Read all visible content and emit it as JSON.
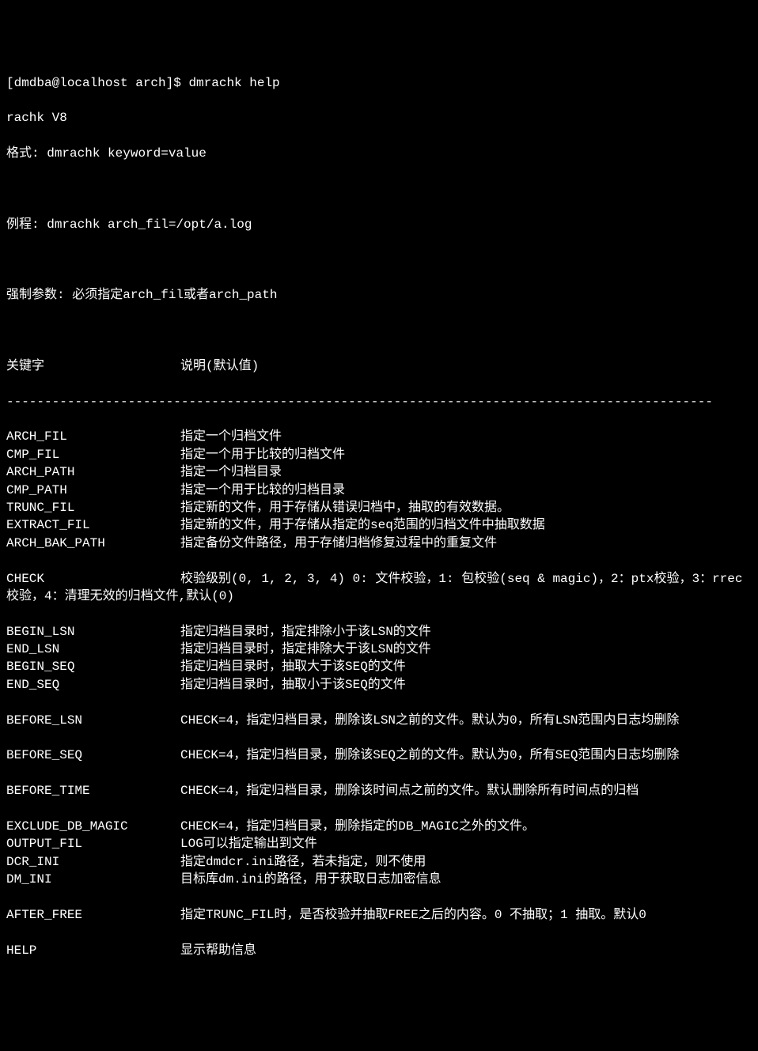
{
  "prompt": "[dmdba@localhost arch]$ ",
  "command": "dmrachk help",
  "version": "rachk V8",
  "usage_label": "格式: ",
  "usage_value": "dmrachk keyword=value",
  "example_label": "例程: ",
  "example_value": "dmrachk arch_fil=/opt/a.log",
  "required_label": "强制参数: ",
  "required_value": "必须指定arch_fil或者arch_path",
  "header_key": "关键字",
  "header_desc": "说明(默认值)",
  "divider": "---------------------------------------------------------------------------------------------",
  "rows": [
    {
      "key": "ARCH_FIL",
      "desc": "指定一个归档文件"
    },
    {
      "key": "CMP_FIL",
      "desc": "指定一个用于比较的归档文件"
    },
    {
      "key": "ARCH_PATH",
      "desc": "指定一个归档目录"
    },
    {
      "key": "CMP_PATH",
      "desc": "指定一个用于比较的归档目录"
    },
    {
      "key": "TRUNC_FIL",
      "desc": "指定新的文件，用于存储从错误归档中，抽取的有效数据。"
    },
    {
      "key": "EXTRACT_FIL",
      "desc": "指定新的文件，用于存储从指定的seq范围的归档文件中抽取数据"
    },
    {
      "key": "ARCH_BAK_PATH",
      "desc": "指定备份文件路径，用于存储归档修复过程中的重复文件"
    }
  ],
  "check_row": {
    "key": "CHECK",
    "desc_full": "校验级别(0, 1, 2, 3, 4) 0: 文件校验，1: 包校验(seq & magic)，2：ptx校验，3：rrec校验，4：清理无效的归档文件,默认(0)"
  },
  "rows2": [
    {
      "key": "BEGIN_LSN",
      "desc": "指定归档目录时，指定排除小于该LSN的文件"
    },
    {
      "key": "END_LSN",
      "desc": "指定归档目录时，指定排除大于该LSN的文件"
    },
    {
      "key": "BEGIN_SEQ",
      "desc": "指定归档目录时，抽取大于该SEQ的文件"
    },
    {
      "key": "END_SEQ",
      "desc": "指定归档目录时，抽取小于该SEQ的文件"
    }
  ],
  "before_lsn_row": {
    "key": "BEFORE_LSN",
    "desc_full": "CHECK=4，指定归档目录，删除该LSN之前的文件。默认为0，所有LSN范围内日志均删除"
  },
  "before_seq_row": {
    "key": "BEFORE_SEQ",
    "desc_full": "CHECK=4，指定归档目录，删除该SEQ之前的文件。默认为0，所有SEQ范围内日志均删除"
  },
  "before_time_row": {
    "key": "BEFORE_TIME",
    "desc_full": "CHECK=4，指定归档目录，删除该时间点之前的文件。默认删除所有时间点的归档"
  },
  "rows3": [
    {
      "key": "EXCLUDE_DB_MAGIC",
      "desc": "CHECK=4，指定归档目录，删除指定的DB_MAGIC之外的文件。"
    },
    {
      "key": "OUTPUT_FIL",
      "desc": "LOG可以指定输出到文件"
    },
    {
      "key": "DCR_INI",
      "desc": "指定dmdcr.ini路径，若未指定，则不使用"
    },
    {
      "key": "DM_INI",
      "desc": "目标库dm.ini的路径，用于获取日志加密信息"
    }
  ],
  "after_free_row": {
    "key": "AFTER_FREE",
    "desc_full": "指定TRUNC_FIL时，是否校验并抽取FREE之后的内容。0 不抽取；1 抽取。默认0"
  },
  "help_row": {
    "key": "HELP",
    "desc": "显示帮助信息"
  }
}
